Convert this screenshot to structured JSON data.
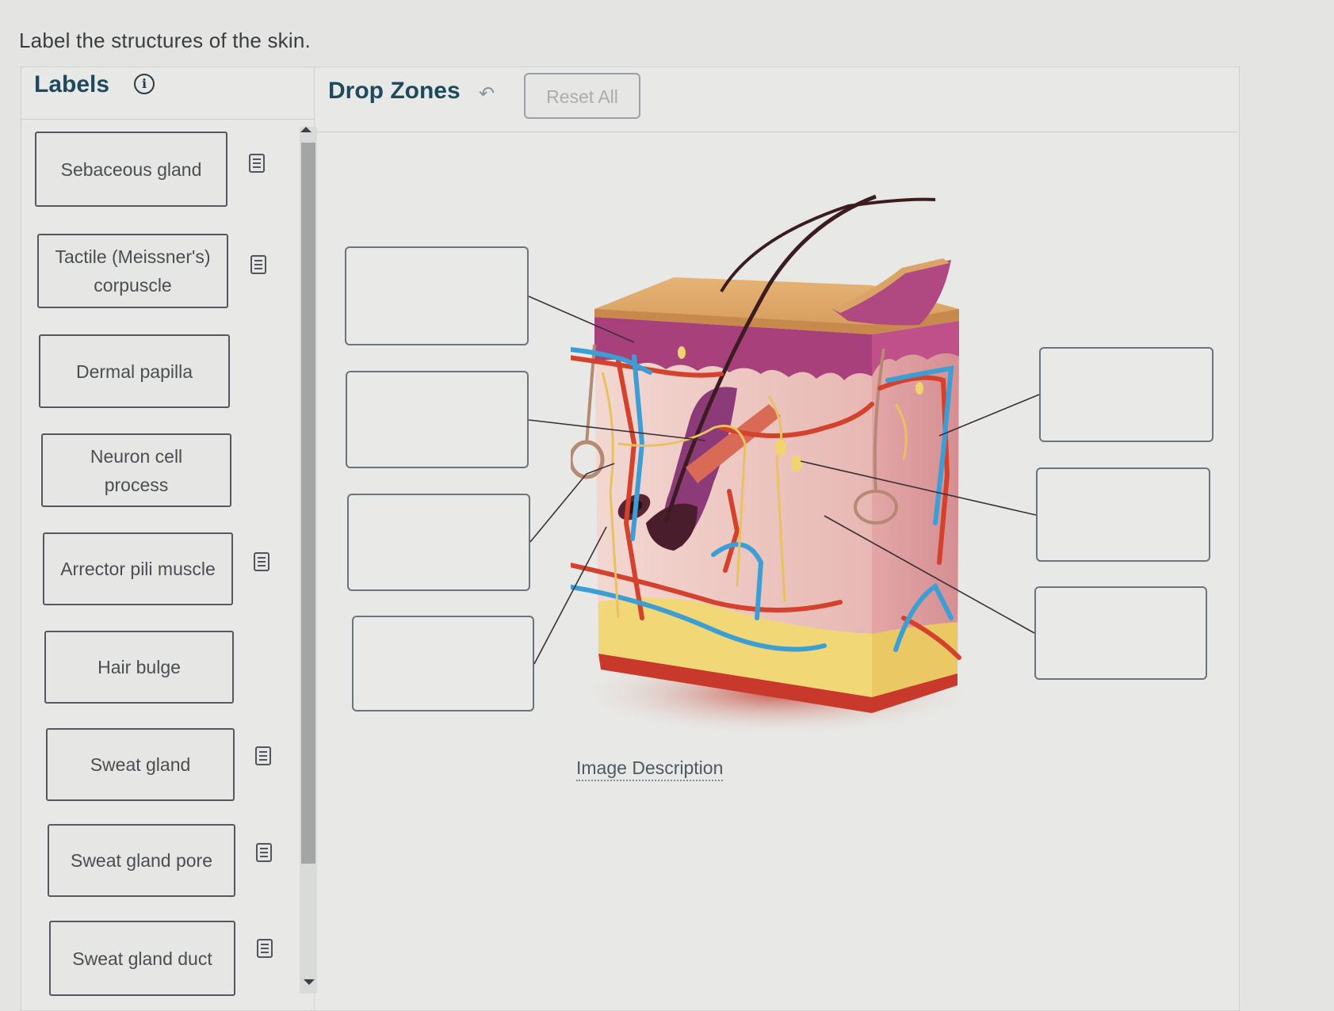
{
  "question": "Label the structures of the skin.",
  "labels_panel": {
    "title": "Labels",
    "info_icon": "info-circle-icon",
    "items": [
      {
        "label": "Sebaceous gland",
        "has_doc_icon": true
      },
      {
        "label": "Tactile (Meissner's) corpuscle",
        "has_doc_icon": true
      },
      {
        "label": "Dermal papilla",
        "has_doc_icon": false
      },
      {
        "label": "Neuron cell process",
        "has_doc_icon": false
      },
      {
        "label": "Arrector pili muscle",
        "has_doc_icon": true
      },
      {
        "label": "Hair bulge",
        "has_doc_icon": false
      },
      {
        "label": "Sweat gland",
        "has_doc_icon": true
      },
      {
        "label": "Sweat gland pore",
        "has_doc_icon": true
      },
      {
        "label": "Sweat gland duct",
        "has_doc_icon": true
      }
    ],
    "doc_icon": "document-icon"
  },
  "drop_zones_panel": {
    "title": "Drop Zones",
    "undo_icon": "undo-arrow-icon",
    "undo_glyph": "↶",
    "reset_label": "Reset All",
    "zones_left_count": 4,
    "zones_right_count": 3,
    "figure_alt": "Cross-section illustration of skin showing epidermis, dermis, hypodermis, hair follicle, glands, vessels and nerves",
    "image_description_link": "Image Description"
  },
  "info_glyph": "i",
  "colors": {
    "heading": "#1f4a5e",
    "artery": "#d4412c",
    "vein": "#3b9fd6",
    "nerve": "#e8c160",
    "epidermis": "#d9a566",
    "stratum": "#a8417b",
    "dermis": "#efc9c4",
    "fat": "#f2d776"
  }
}
